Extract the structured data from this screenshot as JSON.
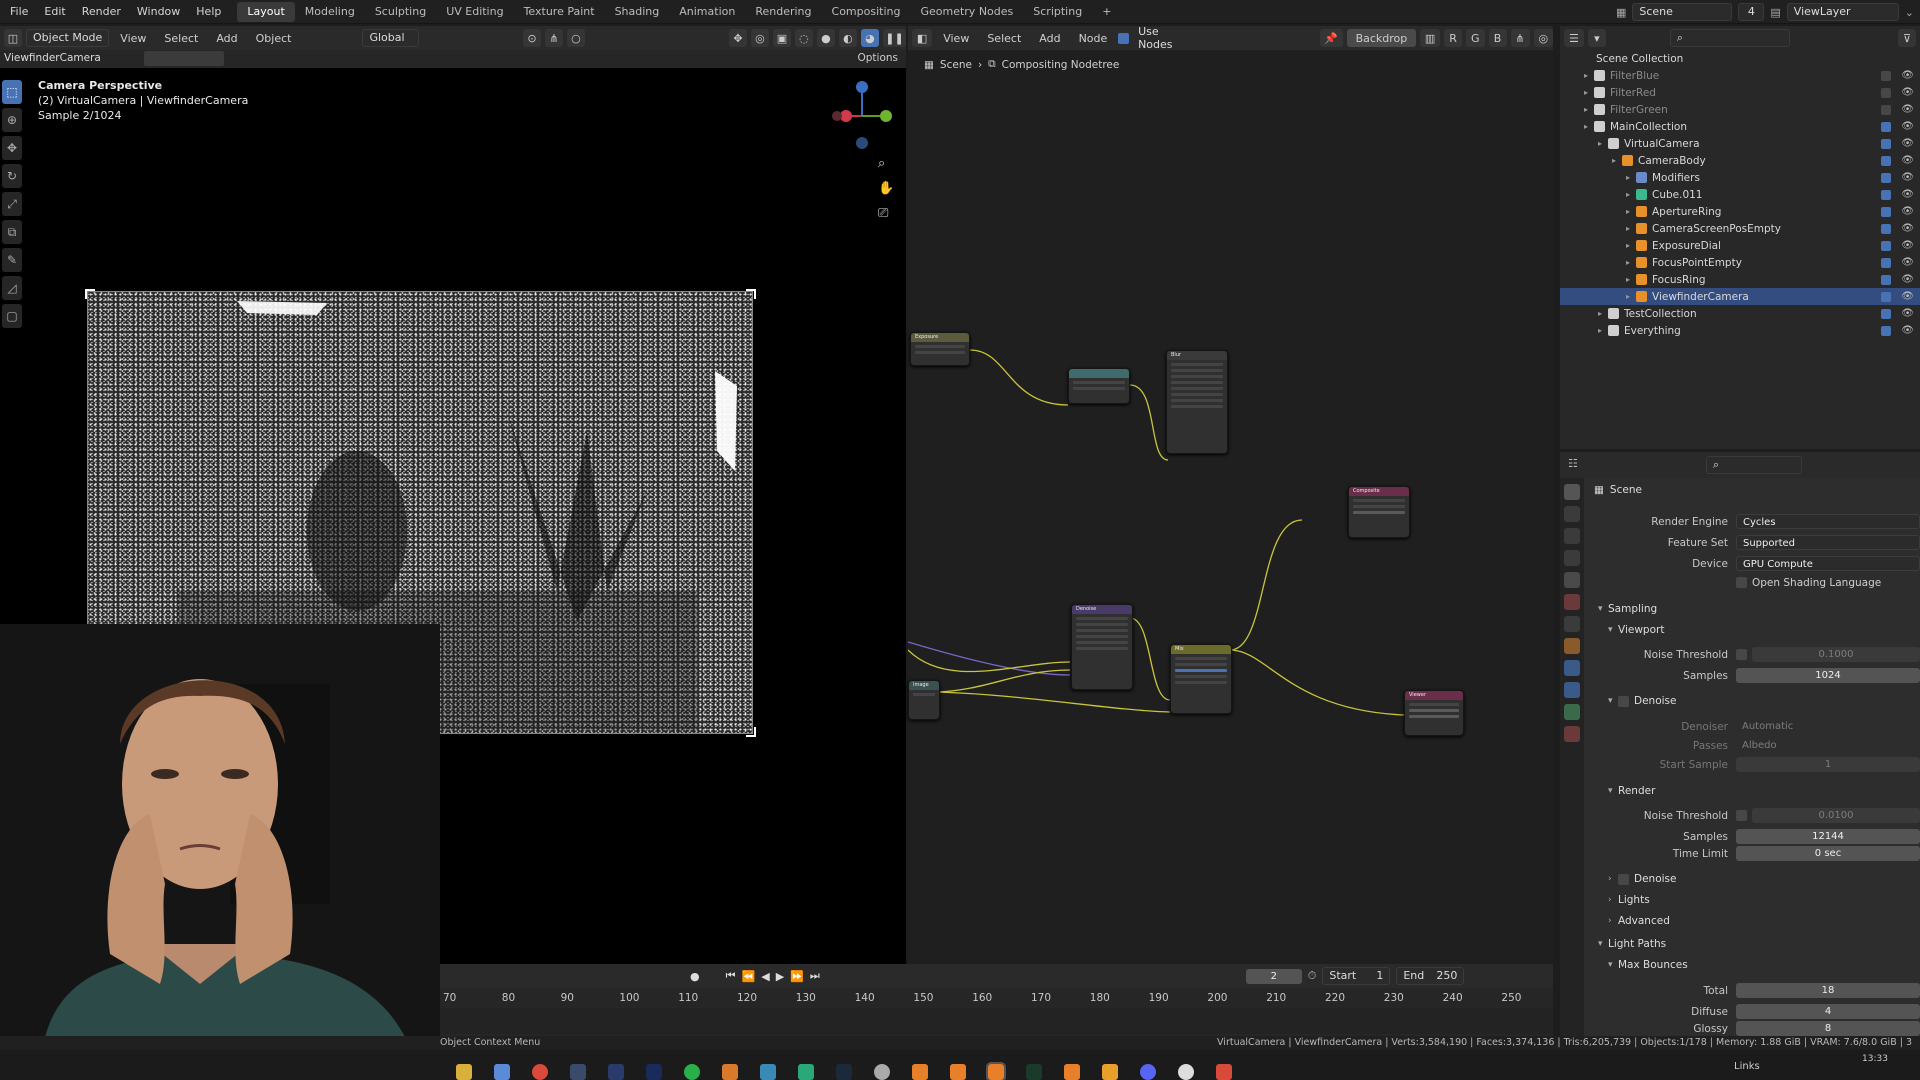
{
  "topbar": {
    "menus": [
      "File",
      "Edit",
      "Render",
      "Window",
      "Help"
    ],
    "workspaces": [
      "Layout",
      "Modeling",
      "Sculpting",
      "UV Editing",
      "Texture Paint",
      "Shading",
      "Animation",
      "Rendering",
      "Compositing",
      "Geometry Nodes",
      "Scripting",
      "+"
    ],
    "active_workspace": "Layout",
    "scene": "Scene",
    "view_layer": "ViewLayer",
    "scene_users": "4"
  },
  "viewport_header": {
    "mode": "Object Mode",
    "menus": [
      "View",
      "Select",
      "Add",
      "Object"
    ],
    "orientation": "Global",
    "camera_name": "ViewfinderCamera",
    "options": "Options"
  },
  "viewport": {
    "line1": "Camera Perspective",
    "line2": "(2) VirtualCamera | ViewfinderCamera",
    "line3": "Sample 2/1024"
  },
  "node_header": {
    "menus": [
      "View",
      "Select",
      "Add",
      "Node"
    ],
    "use_nodes": "Use Nodes",
    "backdrop": "Backdrop",
    "channels": [
      "R",
      "G",
      "B"
    ],
    "breadcrumb_scene": "Scene",
    "breadcrumb_tree": "Compositing Nodetree"
  },
  "nodes": {
    "denoise_title": "Denoise",
    "composite_title": "Composite",
    "viewer_title": "Viewer",
    "mix_title": "Mix",
    "blur_title": "Blur",
    "exposure_title": "Exposure",
    "input_label": "Image"
  },
  "outliner": {
    "root": "Scene Collection",
    "items": [
      {
        "name": "FilterBlue",
        "level": 1,
        "dim": true,
        "icon": "collection-icon"
      },
      {
        "name": "FilterRed",
        "level": 1,
        "dim": true,
        "icon": "collection-icon"
      },
      {
        "name": "FilterGreen",
        "level": 1,
        "dim": true,
        "icon": "collection-icon"
      },
      {
        "name": "MainCollection",
        "level": 1,
        "dim": false,
        "icon": "collection-icon"
      },
      {
        "name": "VirtualCamera",
        "level": 2,
        "dim": false,
        "icon": "collection-icon"
      },
      {
        "name": "CameraBody",
        "level": 3,
        "dim": false,
        "icon": "mesh-icon"
      },
      {
        "name": "Modifiers",
        "level": 4,
        "dim": false,
        "icon": "wrench-icon"
      },
      {
        "name": "Cube.011",
        "level": 4,
        "dim": false,
        "icon": "mesh-data-icon"
      },
      {
        "name": "ApertureRing",
        "level": 4,
        "dim": false,
        "icon": "mesh-icon"
      },
      {
        "name": "CameraScreenPosEmpty",
        "level": 4,
        "dim": false,
        "icon": "empty-icon"
      },
      {
        "name": "ExposureDial",
        "level": 4,
        "dim": false,
        "icon": "mesh-icon"
      },
      {
        "name": "FocusPointEmpty",
        "level": 4,
        "dim": false,
        "icon": "empty-icon"
      },
      {
        "name": "FocusRing",
        "level": 4,
        "dim": false,
        "icon": "mesh-icon"
      },
      {
        "name": "ViewfinderCamera",
        "level": 4,
        "dim": false,
        "icon": "camera-icon",
        "selected": true
      },
      {
        "name": "TestCollection",
        "level": 2,
        "dim": false,
        "icon": "collection-icon"
      },
      {
        "name": "Everything",
        "level": 2,
        "dim": false,
        "icon": "collection-icon"
      }
    ]
  },
  "properties": {
    "context": "Scene",
    "render_engine_label": "Render Engine",
    "render_engine": "Cycles",
    "feature_set_label": "Feature Set",
    "feature_set": "Supported",
    "device_label": "Device",
    "device": "GPU Compute",
    "osl": "Open Shading Language",
    "sampling": "Sampling",
    "viewport": "Viewport",
    "noise_threshold_label": "Noise Threshold",
    "vp_noise_threshold": "0.1000",
    "samples_label": "Samples",
    "vp_samples": "1024",
    "denoise": "Denoise",
    "denoiser_label": "Denoiser",
    "denoiser": "Automatic",
    "passes_label": "Passes",
    "passes": "Albedo",
    "start_sample_label": "Start Sample",
    "start_sample": "1",
    "render": "Render",
    "r_noise_threshold": "0.0100",
    "r_samples": "12144",
    "time_limit_label": "Time Limit",
    "time_limit": "0 sec",
    "lights": "Lights",
    "advanced": "Advanced",
    "light_paths": "Light Paths",
    "max_bounces": "Max Bounces",
    "total_label": "Total",
    "total": "18",
    "diffuse_label": "Diffuse",
    "diffuse": "4",
    "glossy_label": "Glossy",
    "glossy": "8"
  },
  "timeline": {
    "current_frame": "2",
    "start_label": "Start",
    "start": "1",
    "end_label": "End",
    "end": "250",
    "ticks": [
      "70",
      "80",
      "90",
      "100",
      "110",
      "120",
      "130",
      "140",
      "150",
      "160",
      "170",
      "180",
      "190",
      "200",
      "210",
      "220",
      "230",
      "240",
      "250"
    ]
  },
  "status": {
    "left": "Object Context Menu",
    "right": "VirtualCamera | ViewfinderCamera | Verts:3,584,190 | Faces:3,374,136 | Tris:6,205,739 | Objects:1/178 | Memory: 1.88 GiB | VRAM: 7.6/8.0 GiB | 3"
  },
  "taskbar": {
    "links": "Links",
    "clock": "13:33"
  },
  "colors": {
    "accent": "#4772b3",
    "selection": "#334d80",
    "noodle": "#c9c43b",
    "noodle_purple": "#7b68c8"
  }
}
